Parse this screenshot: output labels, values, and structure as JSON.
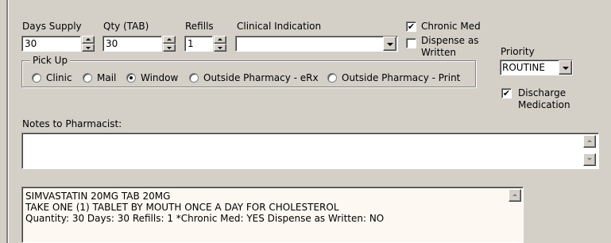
{
  "labels": {
    "days_supply": "Days Supply",
    "qty": "Qty (TAB)",
    "refills": "Refills",
    "clinical_indication": "Clinical Indication",
    "priority": "Priority",
    "notes": "Notes to Pharmacist:"
  },
  "fields": {
    "days_supply": "30",
    "qty": "30",
    "refills": "1",
    "clinical_indication": "",
    "priority": "ROUTINE",
    "notes": ""
  },
  "checkboxes": {
    "chronic_med": {
      "label": "Chronic Med",
      "checked": true
    },
    "dispense_as_written": {
      "label_line1": "Dispense as",
      "label_line2": "Written",
      "checked": false
    },
    "discharge_medication": {
      "label_line1": "Discharge",
      "label_line2": "Medication",
      "checked": true
    }
  },
  "pickup": {
    "title": "Pick Up",
    "options": [
      "Clinic",
      "Mail",
      "Window",
      "Outside Pharmacy - eRx",
      "Outside Pharmacy - Print"
    ],
    "selected": "Window"
  },
  "order_summary": {
    "line1": "SIMVASTATIN 20MG TAB  20MG",
    "line2": "TAKE ONE (1) TABLET BY MOUTH ONCE A DAY FOR CHOLESTEROL",
    "line3": "Quantity: 30  Days: 30 Refills: 1 *Chronic Med: YES Dispense as Written: NO"
  },
  "check_glyph": "✔"
}
